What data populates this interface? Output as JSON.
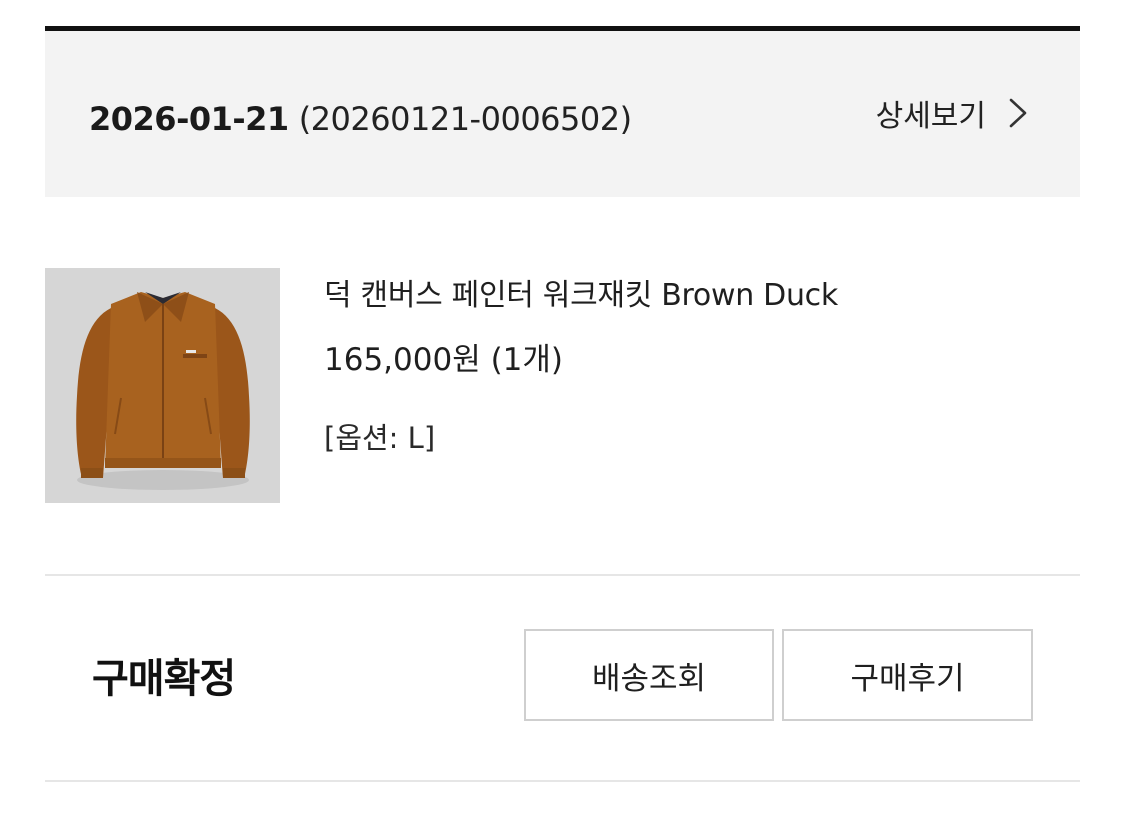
{
  "order": {
    "date": "2026-01-21",
    "number": "(20260121-0006502)",
    "detail_label": "상세보기",
    "detail_icon": "chevron-right-icon"
  },
  "product": {
    "image_alt": "brown duck canvas work jacket",
    "name": "덕 캔버스 페인터 워크재킷 Brown Duck",
    "price": "165,000원 (1개)",
    "option": "[옵션: L]",
    "colors": {
      "jacket": "#a8621f",
      "background": "#d8d8d8"
    }
  },
  "status": {
    "label": "구매확정",
    "buttons": {
      "track": "배송조회",
      "review": "구매후기"
    }
  },
  "colors": {
    "header_bg": "#f3f3f3",
    "top_rule": "#111111",
    "divider": "#e6e6e6",
    "button_border": "#cfcfcf"
  }
}
